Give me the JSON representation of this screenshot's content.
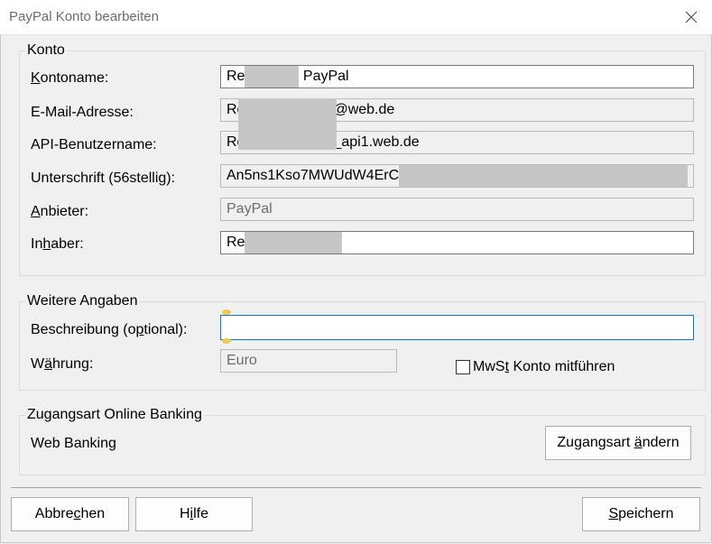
{
  "window": {
    "title": "PayPal Konto bearbeiten",
    "close_glyph": "✕"
  },
  "konto": {
    "group_label": "Konto",
    "kontoname_label": "Kontoname:",
    "kontoname_value_prefix": "Re",
    "kontoname_value_suffix": " PayPal",
    "email_label": "E-Mail-Adresse:",
    "email_value_prefix": "Re",
    "email_value_suffix": "@web.de",
    "api_label": "API-Benutzername:",
    "api_value_prefix": "Re",
    "api_value_suffix": "_api1.web.de",
    "signature_label": "Unterschrift (56stellig):",
    "signature_value_prefix": "An5ns1Kso7MWUdW4ErC",
    "anbieter_label": "Anbieter:",
    "anbieter_value": "PayPal",
    "inhaber_label": "Inhaber:",
    "inhaber_value_prefix": "Re"
  },
  "weitere": {
    "group_label": "Weitere Angaben",
    "beschreibung_label": "Beschreibung (optional):",
    "beschreibung_value": "",
    "waehrung_label": "Währung:",
    "waehrung_value": "Euro",
    "mwst_label": "MwSt Konto mitführen",
    "mwst_checked": false
  },
  "zugang": {
    "group_label": "Zugangsart Online Banking",
    "type_value": "Web Banking",
    "change_button": "Zugangsart ändern"
  },
  "footer": {
    "cancel_button": "Abbrechen",
    "help_button": "Hilfe",
    "save_button": "Speichern"
  }
}
